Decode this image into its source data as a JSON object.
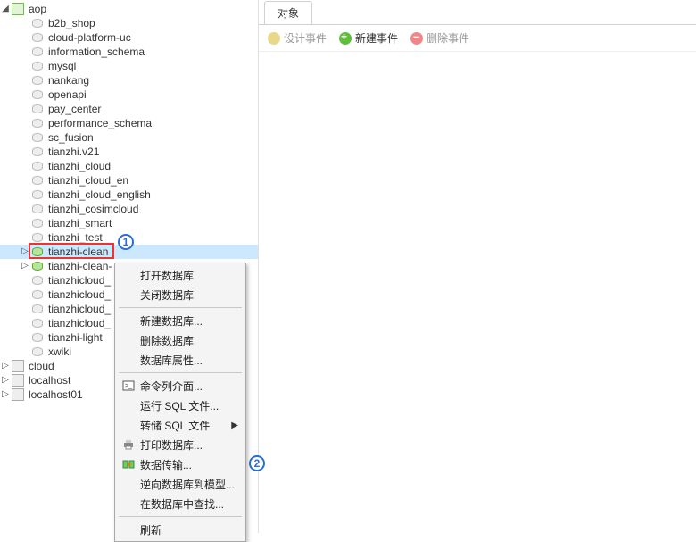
{
  "tree": {
    "root": {
      "label": "aop",
      "expanded": true
    },
    "databases": [
      {
        "label": "b2b_shop",
        "active": false
      },
      {
        "label": "cloud-platform-uc",
        "active": false
      },
      {
        "label": "information_schema",
        "active": false
      },
      {
        "label": "mysql",
        "active": false
      },
      {
        "label": "nankang",
        "active": false
      },
      {
        "label": "openapi",
        "active": false
      },
      {
        "label": "pay_center",
        "active": false
      },
      {
        "label": "performance_schema",
        "active": false
      },
      {
        "label": "sc_fusion",
        "active": false
      },
      {
        "label": "tianzhi.v21",
        "active": false
      },
      {
        "label": "tianzhi_cloud",
        "active": false
      },
      {
        "label": "tianzhi_cloud_en",
        "active": false
      },
      {
        "label": "tianzhi_cloud_english",
        "active": false
      },
      {
        "label": "tianzhi_cosimcloud",
        "active": false
      },
      {
        "label": "tianzhi_smart",
        "active": false
      },
      {
        "label": "tianzhi_test",
        "active": false
      },
      {
        "label": "tianzhi-clean",
        "active": true,
        "expander": "▷",
        "selected": true,
        "highlight": true
      },
      {
        "label": "tianzhi-clean-",
        "active": true,
        "expander": "▷",
        "truncated": true
      },
      {
        "label": "tianzhicloud_",
        "active": false,
        "truncated": true
      },
      {
        "label": "tianzhicloud_",
        "active": false,
        "truncated": true
      },
      {
        "label": "tianzhicloud_",
        "active": false,
        "truncated": true
      },
      {
        "label": "tianzhicloud_",
        "active": false,
        "truncated": true
      },
      {
        "label": "tianzhi-light",
        "active": false
      },
      {
        "label": "xwiki",
        "active": false
      }
    ],
    "connections": [
      {
        "label": "cloud"
      },
      {
        "label": "localhost"
      },
      {
        "label": "localhost01"
      }
    ]
  },
  "context_menu": {
    "items": [
      {
        "label": "打开数据库"
      },
      {
        "label": "关闭数据库"
      },
      {
        "sep": true
      },
      {
        "label": "新建数据库..."
      },
      {
        "label": "删除数据库"
      },
      {
        "label": "数据库属性..."
      },
      {
        "sep": true
      },
      {
        "label": "命令列介面...",
        "icon": "cmd"
      },
      {
        "label": "运行 SQL 文件..."
      },
      {
        "label": "转储 SQL 文件",
        "submenu": true
      },
      {
        "label": "打印数据库...",
        "icon": "print"
      },
      {
        "label": "数据传输...",
        "icon": "transfer",
        "highlight": true
      },
      {
        "label": "逆向数据库到模型..."
      },
      {
        "label": "在数据库中查找..."
      },
      {
        "sep": true
      },
      {
        "label": "刷新"
      }
    ]
  },
  "right": {
    "tab": "对象",
    "toolbar": {
      "design": "设计事件",
      "new": "新建事件",
      "delete": "删除事件"
    }
  },
  "badges": {
    "one": "1",
    "two": "2"
  }
}
